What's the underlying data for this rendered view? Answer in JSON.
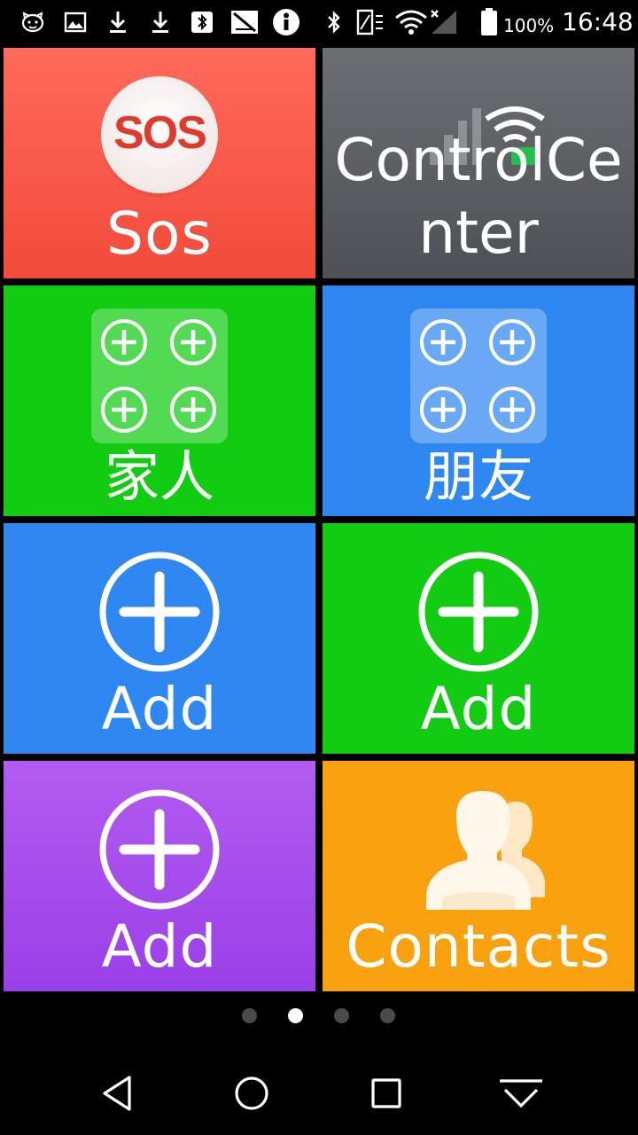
{
  "status_bar": {
    "battery_percent": "100%",
    "time": "16:48",
    "icons": [
      "cat-face-icon",
      "image-icon",
      "download-icon",
      "download-icon",
      "bluetooth-off-icon",
      "no-signal-icon",
      "info-icon",
      "bluetooth-icon",
      "vibrate-icon",
      "wifi-icon",
      "signal-icon",
      "battery-icon"
    ]
  },
  "tiles": [
    {
      "id": "sos",
      "label": "Sos",
      "icon_text": "SOS",
      "icon": "sos-icon",
      "color": "#f55a4a"
    },
    {
      "id": "control-center",
      "label": "ControlCenter",
      "icon": "wifi-signal-icon",
      "color": "#5c5f64"
    },
    {
      "id": "family",
      "label": "家人",
      "icon": "add-contacts-grid-icon",
      "color": "#11cc11"
    },
    {
      "id": "friends",
      "label": "朋友",
      "icon": "add-contacts-grid-icon",
      "color": "#2f87f2"
    },
    {
      "id": "add-1",
      "label": "Add",
      "icon": "plus-circle-icon",
      "color": "#2f87f2"
    },
    {
      "id": "add-2",
      "label": "Add",
      "icon": "plus-circle-icon",
      "color": "#11cc11"
    },
    {
      "id": "add-3",
      "label": "Add",
      "icon": "plus-circle-icon",
      "color": "#a64cec"
    },
    {
      "id": "contacts",
      "label": "Contacts",
      "icon": "contacts-icon",
      "color": "#f9a10e"
    }
  ],
  "page_indicator": {
    "count": 4,
    "active_index": 1
  },
  "nav_bar": {
    "buttons": [
      "back-icon",
      "home-icon",
      "recents-icon",
      "notification-pull-icon"
    ]
  }
}
